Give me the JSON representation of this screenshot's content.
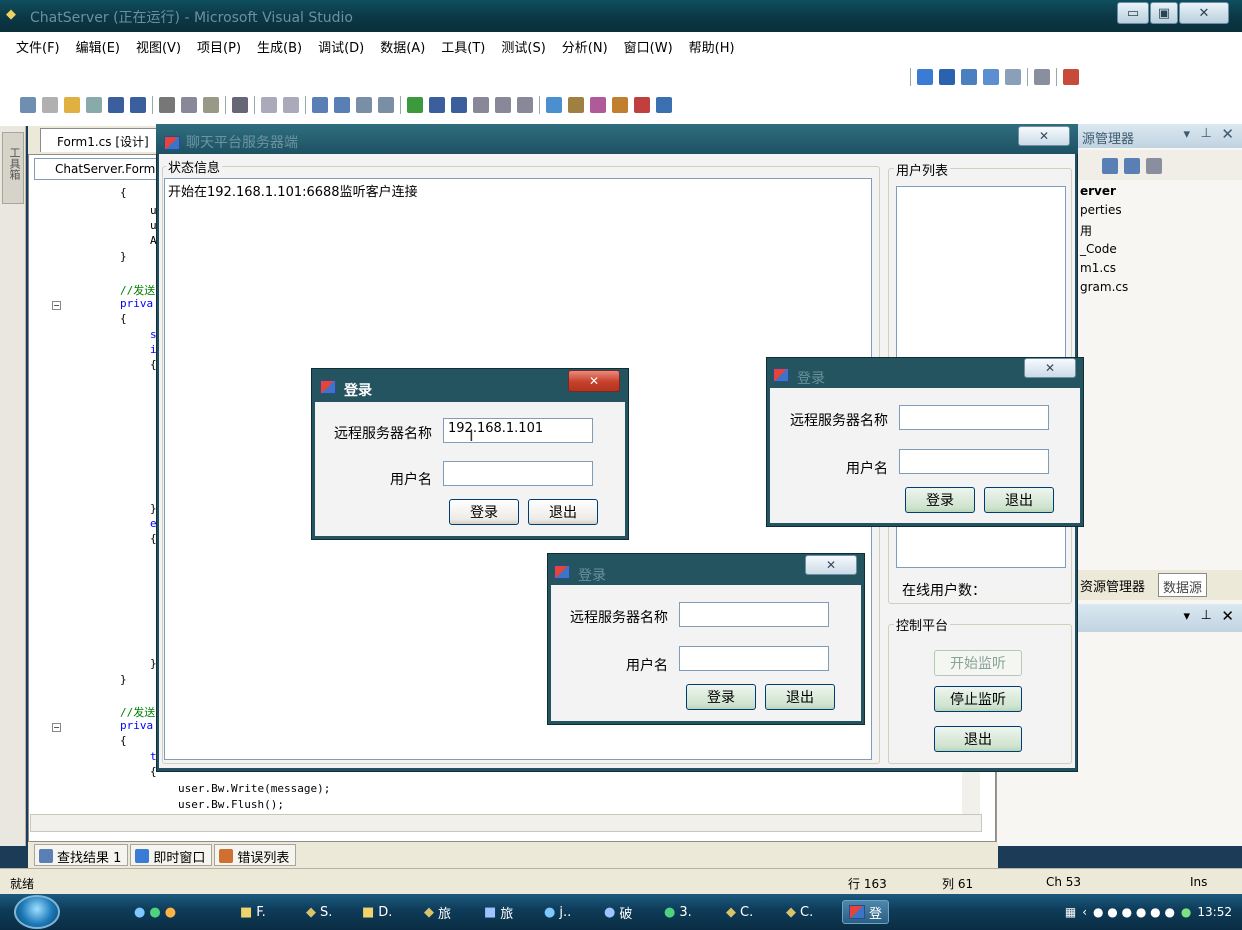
{
  "vs": {
    "title": "ChatServer (正在运行) - Microsoft Visual Studio",
    "caption_min": "▭",
    "caption_max": "▣",
    "caption_close": "✕",
    "menu": [
      {
        "label": "文件(F)"
      },
      {
        "label": "编辑(E)"
      },
      {
        "label": "视图(V)"
      },
      {
        "label": "项目(P)"
      },
      {
        "label": "生成(B)"
      },
      {
        "label": "调试(D)"
      },
      {
        "label": "数据(A)"
      },
      {
        "label": "工具(T)"
      },
      {
        "label": "测试(S)"
      },
      {
        "label": "分析(N)"
      },
      {
        "label": "窗口(W)"
      },
      {
        "label": "帮助(H)"
      }
    ],
    "left_toolbox_label": "工具箱",
    "doc_tab": "Form1.cs [设计]",
    "nav_combo": "ChatServer.Form1",
    "code": [
      {
        "text": "{"
      },
      {
        "text": "u"
      },
      {
        "text": "u"
      },
      {
        "text": "A"
      },
      {
        "text": "}"
      },
      {
        "text": "//发送"
      },
      {
        "text": "priva"
      },
      {
        "text": "{"
      },
      {
        "text": "s"
      },
      {
        "text": "i"
      },
      {
        "text": "{"
      },
      {
        "text": "}"
      },
      {
        "text": "e"
      },
      {
        "text": "{"
      },
      {
        "text": "}"
      },
      {
        "text": "}"
      },
      {
        "text": "//发送"
      },
      {
        "text": "priva"
      },
      {
        "text": "{"
      },
      {
        "text": "t"
      },
      {
        "text": "{"
      },
      {
        "text": "user.Bw.Write(message);"
      },
      {
        "text": "user.Bw.Flush();"
      }
    ],
    "solution_explorer": {
      "title": "源管理器",
      "items": [
        "erver",
        "perties",
        "用",
        "_Code",
        "m1.cs",
        "gram.cs"
      ],
      "bottom_tab_1": "资源管理器",
      "bottom_tab_2": "数据源"
    },
    "output_tabs": [
      {
        "label": "查找结果 1"
      },
      {
        "label": "即时窗口"
      },
      {
        "label": "错误列表"
      }
    ],
    "status": {
      "ready": "就绪",
      "line": "行 163",
      "col": "列 61",
      "ch": "Ch 53",
      "ins": "Ins"
    }
  },
  "server": {
    "title": "聊天平台服务器端",
    "close": "✕",
    "status_group": "状态信息",
    "status_text": "开始在192.168.1.101:6688监听客户连接",
    "user_group": "用户列表",
    "online_count_label": "在线用户数：",
    "control_group": "控制平台",
    "start_button": "开始监听",
    "stop_button": "停止监听",
    "exit_button": "退出"
  },
  "login_active": {
    "title": "登录",
    "close": "✕",
    "server_label": "远程服务器名称",
    "server_value": "192.168.1.101",
    "user_label": "用户名",
    "user_value": "",
    "login_button": "登录",
    "exit_button": "退出"
  },
  "login_b": {
    "title": "登录",
    "close": "✕",
    "server_label": "远程服务器名称",
    "server_value": "",
    "user_label": "用户名",
    "user_value": "",
    "login_button": "登录",
    "exit_button": "退出"
  },
  "login_c": {
    "title": "登录",
    "close": "✕",
    "server_label": "远程服务器名称",
    "server_value": "",
    "user_label": "用户名",
    "user_value": "",
    "login_button": "登录",
    "exit_button": "退出"
  },
  "taskbar": {
    "items": [
      {
        "label": "F."
      },
      {
        "label": "S."
      },
      {
        "label": "D."
      },
      {
        "label": "旅"
      },
      {
        "label": "旅"
      },
      {
        "label": "j.."
      },
      {
        "label": "破"
      },
      {
        "label": "3."
      },
      {
        "label": "C."
      },
      {
        "label": "C."
      },
      {
        "label": "登"
      }
    ],
    "clock": "13:52"
  }
}
